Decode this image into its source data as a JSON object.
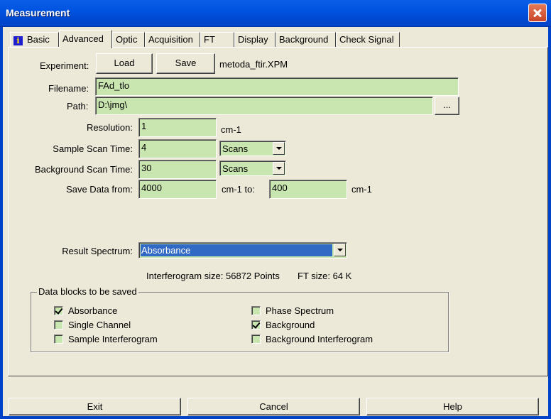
{
  "window": {
    "title": "Measurement"
  },
  "tabs": [
    {
      "label": "Basic",
      "icon": "info-icon"
    },
    {
      "label": "Advanced"
    },
    {
      "label": "Optic"
    },
    {
      "label": "Acquisition"
    },
    {
      "label": "FT"
    },
    {
      "label": "Display"
    },
    {
      "label": "Background"
    },
    {
      "label": "Check Signal"
    }
  ],
  "experiment": {
    "label": "Experiment:",
    "load_label": "Load",
    "save_label": "Save",
    "file": "metoda_ftir.XPM"
  },
  "filename": {
    "label": "Filename:",
    "value": "FAd_tlo"
  },
  "path": {
    "label": "Path:",
    "value": "D:\\jmg\\",
    "browse_label": "..."
  },
  "resolution": {
    "label": "Resolution:",
    "value": "1",
    "unit": "cm-1"
  },
  "sample_scan": {
    "label": "Sample Scan Time:",
    "value": "4",
    "unit": "Scans"
  },
  "background_scan": {
    "label": "Background Scan Time:",
    "value": "30",
    "unit": "Scans"
  },
  "save_data": {
    "label": "Save Data from:",
    "from": "4000",
    "mid_label": "cm-1 to:",
    "to": "400",
    "unit": "cm-1"
  },
  "result_spectrum": {
    "label": "Result Spectrum:",
    "value": "Absorbance"
  },
  "info": {
    "interferogram": "Interferogram size: 56872 Points",
    "ft_size": "FT size: 64 K"
  },
  "data_blocks": {
    "title": "Data blocks to be saved",
    "items": [
      {
        "label": "Absorbance",
        "checked": true
      },
      {
        "label": "Single Channel",
        "checked": false
      },
      {
        "label": "Sample Interferogram",
        "checked": false
      },
      {
        "label": "Phase Spectrum",
        "checked": false
      },
      {
        "label": "Background",
        "checked": true
      },
      {
        "label": "Background Interferogram",
        "checked": false
      }
    ]
  },
  "buttons": {
    "exit": "Exit",
    "cancel": "Cancel",
    "help": "Help"
  },
  "colors": {
    "titlebar": "#0053e0",
    "field_bg": "#c9e6b0",
    "selection": "#316ac5",
    "dialog_bg": "#ece9d8"
  }
}
